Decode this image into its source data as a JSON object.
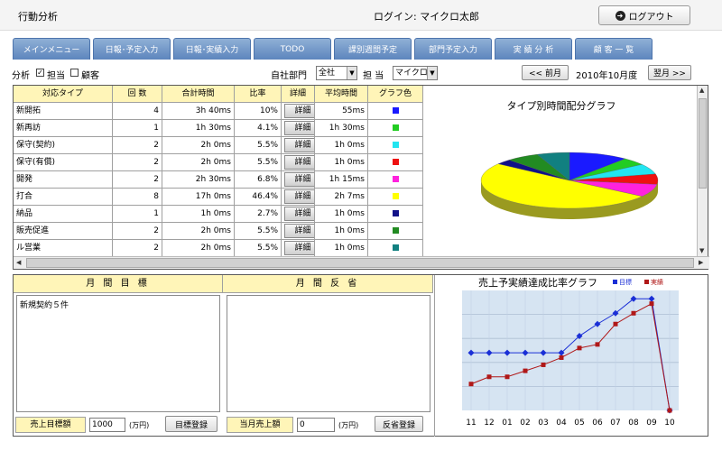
{
  "header": {
    "app_title": "行動分析",
    "login_text": "ログイン: マイクロ太郎",
    "logout_label": "ログアウト"
  },
  "tabs": [
    "メインメニュー",
    "日報･予定入力",
    "日報･実績入力",
    "TODO",
    "課別週間予定",
    "部門予定入力",
    "実 績 分 析",
    "顧 客 一 覧"
  ],
  "filter": {
    "analysis_label": "分析",
    "option_tanto": "担当",
    "option_customer": "顧客",
    "tanto_checked": true,
    "customer_checked": false,
    "department_label": "自社部門",
    "department_value": "全社",
    "person_label": "担 当",
    "person_value": "マイクロ",
    "prev_label": "<< 前月",
    "period_label": "2010年10月度",
    "next_label": "翌月 >>"
  },
  "table": {
    "headers": [
      "対応タイプ",
      "回 数",
      "合計時間",
      "比率",
      "詳細",
      "平均時間",
      "グラフ色"
    ],
    "detail_label": "詳細",
    "rows": [
      {
        "type": "新開拓",
        "count": "4",
        "total": "3h 40ms",
        "ratio": "10%",
        "avg": "55ms",
        "color": "#1a1aff"
      },
      {
        "type": "新再訪",
        "count": "1",
        "total": "1h 30ms",
        "ratio": "4.1%",
        "avg": "1h 30ms",
        "color": "#22cc22"
      },
      {
        "type": "保守(契約)",
        "count": "2",
        "total": "2h 0ms",
        "ratio": "5.5%",
        "avg": "1h 0ms",
        "color": "#22e5f0"
      },
      {
        "type": "保守(有償)",
        "count": "2",
        "total": "2h 0ms",
        "ratio": "5.5%",
        "avg": "1h 0ms",
        "color": "#ee1111"
      },
      {
        "type": "開発",
        "count": "2",
        "total": "2h 30ms",
        "ratio": "6.8%",
        "avg": "1h 15ms",
        "color": "#ff22dd"
      },
      {
        "type": "打合",
        "count": "8",
        "total": "17h 0ms",
        "ratio": "46.4%",
        "avg": "2h 7ms",
        "color": "#ffff00"
      },
      {
        "type": "納品",
        "count": "1",
        "total": "1h 0ms",
        "ratio": "2.7%",
        "avg": "1h 0ms",
        "color": "#111188"
      },
      {
        "type": "販売促進",
        "count": "2",
        "total": "2h 0ms",
        "ratio": "5.5%",
        "avg": "1h 0ms",
        "color": "#228b22"
      },
      {
        "type": "ル営業",
        "count": "2",
        "total": "2h 0ms",
        "ratio": "5.5%",
        "avg": "1h 0ms",
        "color": "#118080"
      }
    ]
  },
  "pie_chart": {
    "title": "タイプ別時間配分グラフ"
  },
  "goals": {
    "monthly_goal_label": "月 間 目 標",
    "monthly_reflection_label": "月 間 反 省",
    "goal_text": "新規契約５件",
    "reflection_text": "",
    "sales_target_label": "売上目標額",
    "sales_target_value": "1000",
    "unit_label": "(万円)",
    "register_goal_label": "目標登録",
    "monthly_sales_label": "当月売上額",
    "monthly_sales_value": "0",
    "register_reflection_label": "反省登録"
  },
  "chart_data": {
    "type": "line",
    "title": "売上予実績達成比率グラフ",
    "categories": [
      "11",
      "12",
      "01",
      "02",
      "03",
      "04",
      "05",
      "06",
      "07",
      "08",
      "09",
      "10"
    ],
    "series": [
      {
        "name": "目標",
        "color": "#1a2fd6",
        "values": [
          48,
          48,
          48,
          48,
          48,
          48,
          62,
          72,
          81,
          93,
          93,
          0
        ]
      },
      {
        "name": "実績",
        "color": "#b01818",
        "values": [
          22,
          28,
          28,
          33,
          38,
          44,
          52,
          55,
          72,
          81,
          89,
          0
        ]
      }
    ],
    "ylim": [
      0,
      100
    ],
    "grid": true,
    "legend": "top-right"
  }
}
